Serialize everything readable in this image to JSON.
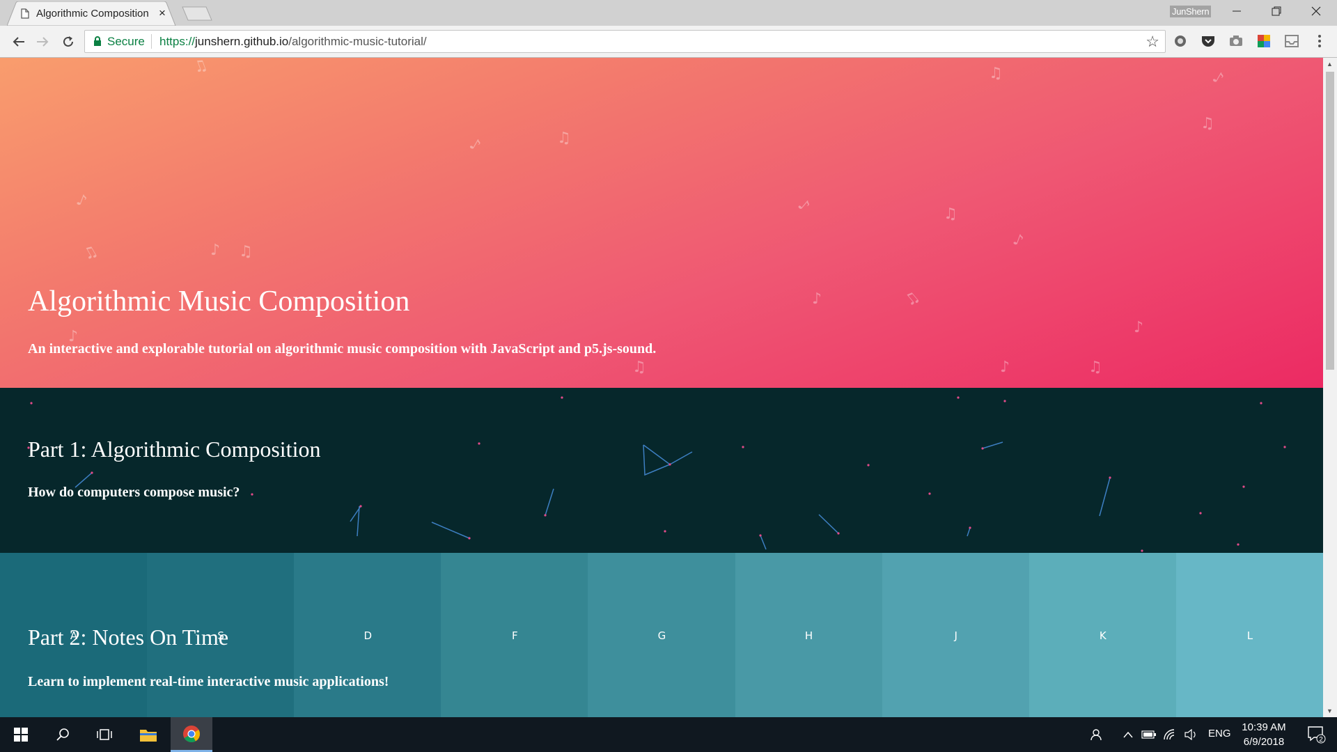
{
  "browser": {
    "tab_title": "Algorithmic Composition",
    "tab_close": "×",
    "profile_name": "JunShern",
    "security_label": "Secure",
    "url_scheme": "https://",
    "url_host": "junshern.github.io",
    "url_path": "/algorithmic-music-tutorial/",
    "star_glyph": "☆"
  },
  "hero": {
    "title": "Algorithmic Music Composition",
    "subtitle": "An interactive and explorable tutorial on algorithmic music composition with JavaScript and p5.js-sound.",
    "gradient_colors": [
      "#f99d6d",
      "#ec2a63"
    ]
  },
  "part1": {
    "title": "Part 1: Algorithmic Composition",
    "subtitle": "How do computers compose music?",
    "background": "#06272b"
  },
  "part2": {
    "title": "Part 2: Notes On Time",
    "subtitle": "Learn to implement real-time interactive music applications!",
    "keys": [
      {
        "label": "A",
        "color": "#1b6a79"
      },
      {
        "label": "S",
        "color": "#206f7e"
      },
      {
        "label": "D",
        "color": "#2a7a89"
      },
      {
        "label": "F",
        "color": "#358692"
      },
      {
        "label": "G",
        "color": "#3e8f9c"
      },
      {
        "label": "H",
        "color": "#4999a6"
      },
      {
        "label": "J",
        "color": "#52a2b0"
      },
      {
        "label": "K",
        "color": "#5caeba"
      },
      {
        "label": "L",
        "color": "#67b7c6"
      }
    ]
  },
  "taskbar": {
    "language": "ENG",
    "time": "10:39 AM",
    "date": "6/9/2018",
    "notification_count": "2"
  }
}
